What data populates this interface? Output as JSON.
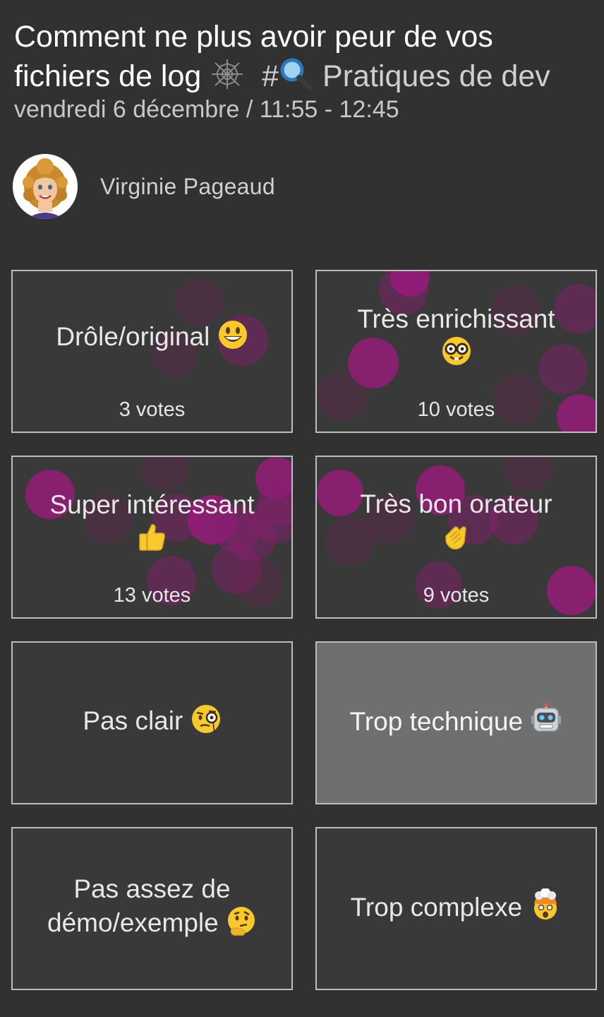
{
  "talk": {
    "title_main": "Comment ne plus avoir peur de vos fichiers de log",
    "title_emoji_icon": "spider-web-icon",
    "track_hash": "#",
    "track_emoji_icon": "magnifier-icon",
    "track_label": "Pratiques de dev",
    "datetime": "vendredi 6 décembre / 11:55 - 12:45"
  },
  "speaker": {
    "name": "Virginie Pageaud",
    "avatar_icon": "speaker-avatar"
  },
  "accent_color": "#a01882",
  "cards": [
    {
      "label": "Drôle/original",
      "emoji_icon": "grinning-face-icon",
      "votes": "3 votes",
      "selected": false
    },
    {
      "label": "Très enrichissant",
      "emoji_icon": "nerd-face-icon",
      "votes": "10 votes",
      "selected": false
    },
    {
      "label": "Super intéressant",
      "emoji_icon": "thumbs-up-icon",
      "votes": "13 votes",
      "selected": false
    },
    {
      "label": "Très bon orateur",
      "emoji_icon": "clapping-hands-icon",
      "votes": "9 votes",
      "selected": false
    },
    {
      "label": "Pas clair",
      "emoji_icon": "face-with-monocle-icon",
      "selected": false
    },
    {
      "label": "Trop technique",
      "emoji_icon": "robot-icon",
      "selected": true
    },
    {
      "label_line1": "Pas assez de",
      "label_line2": "démo/exemple",
      "emoji_icon": "thinking-face-icon",
      "selected": false
    },
    {
      "label": "Trop complexe",
      "emoji_icon": "exploding-head-icon",
      "selected": false
    }
  ]
}
